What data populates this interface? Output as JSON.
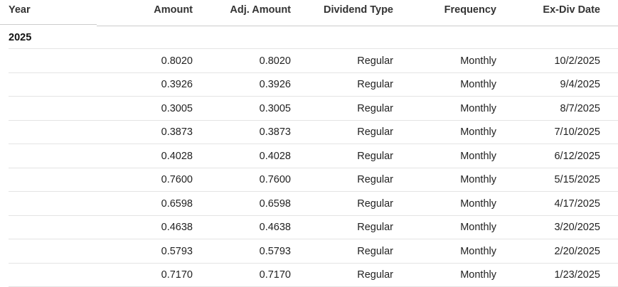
{
  "columns": {
    "year": "Year",
    "amount": "Amount",
    "adj_amount": "Adj. Amount",
    "dividend_type": "Dividend Type",
    "frequency": "Frequency",
    "ex_div_date": "Ex-Div Date"
  },
  "group": {
    "year": "2025"
  },
  "rows": [
    {
      "amount": "0.8020",
      "adj_amount": "0.8020",
      "dividend_type": "Regular",
      "frequency": "Monthly",
      "ex_div_date": "10/2/2025"
    },
    {
      "amount": "0.3926",
      "adj_amount": "0.3926",
      "dividend_type": "Regular",
      "frequency": "Monthly",
      "ex_div_date": "9/4/2025"
    },
    {
      "amount": "0.3005",
      "adj_amount": "0.3005",
      "dividend_type": "Regular",
      "frequency": "Monthly",
      "ex_div_date": "8/7/2025"
    },
    {
      "amount": "0.3873",
      "adj_amount": "0.3873",
      "dividend_type": "Regular",
      "frequency": "Monthly",
      "ex_div_date": "7/10/2025"
    },
    {
      "amount": "0.4028",
      "adj_amount": "0.4028",
      "dividend_type": "Regular",
      "frequency": "Monthly",
      "ex_div_date": "6/12/2025"
    },
    {
      "amount": "0.7600",
      "adj_amount": "0.7600",
      "dividend_type": "Regular",
      "frequency": "Monthly",
      "ex_div_date": "5/15/2025"
    },
    {
      "amount": "0.6598",
      "adj_amount": "0.6598",
      "dividend_type": "Regular",
      "frequency": "Monthly",
      "ex_div_date": "4/17/2025"
    },
    {
      "amount": "0.4638",
      "adj_amount": "0.4638",
      "dividend_type": "Regular",
      "frequency": "Monthly",
      "ex_div_date": "3/20/2025"
    },
    {
      "amount": "0.5793",
      "adj_amount": "0.5793",
      "dividend_type": "Regular",
      "frequency": "Monthly",
      "ex_div_date": "2/20/2025"
    },
    {
      "amount": "0.7170",
      "adj_amount": "0.7170",
      "dividend_type": "Regular",
      "frequency": "Monthly",
      "ex_div_date": "1/23/2025"
    }
  ]
}
